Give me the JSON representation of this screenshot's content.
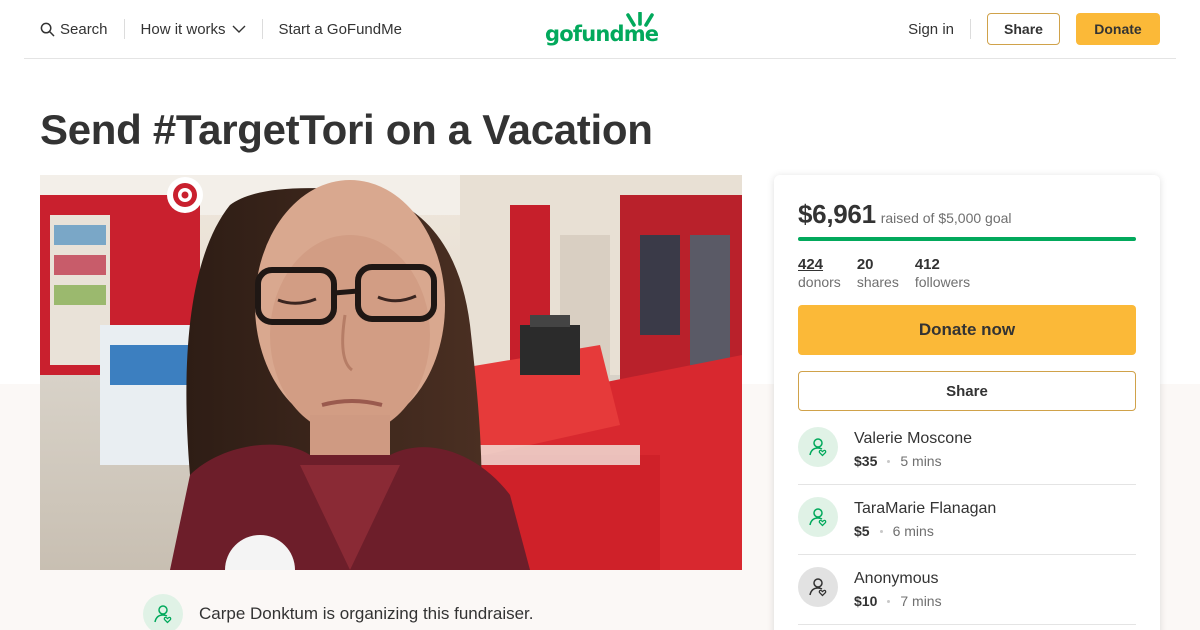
{
  "nav": {
    "search_label": "Search",
    "how_it_works_label": "How it works",
    "start_label": "Start a GoFundMe",
    "logo_text": "gofundme",
    "sign_in_label": "Sign in",
    "share_label": "Share",
    "donate_label": "Donate"
  },
  "campaign": {
    "title": "Send #TargetTori on a Vacation",
    "organizer_text": "Carpe Donktum is organizing this fundraiser."
  },
  "sidebar": {
    "raised_amount": "$6,961",
    "goal_text": "raised of $5,000 goal",
    "progress_fraction": 1.0,
    "stats": [
      {
        "number": "424",
        "label": "donors"
      },
      {
        "number": "20",
        "label": "shares"
      },
      {
        "number": "412",
        "label": "followers"
      }
    ],
    "donate_now_label": "Donate now",
    "share_label": "Share",
    "donations": [
      {
        "name": "Valerie Moscone",
        "amount": "$35",
        "time": "5 mins"
      },
      {
        "name": "TaraMarie Flanagan",
        "amount": "$5",
        "time": "6 mins"
      },
      {
        "name": "Anonymous",
        "amount": "$10",
        "time": "7 mins"
      }
    ]
  },
  "colors": {
    "brand_green": "#02a95c",
    "donate_yellow": "#fbb938",
    "text_dark": "#333333",
    "text_muted": "#6f6f6f"
  },
  "icons": {
    "search": "search-icon",
    "chevron": "chevron-down-icon",
    "donor": "donor-heart-icon",
    "hero": "campaign-photo"
  }
}
